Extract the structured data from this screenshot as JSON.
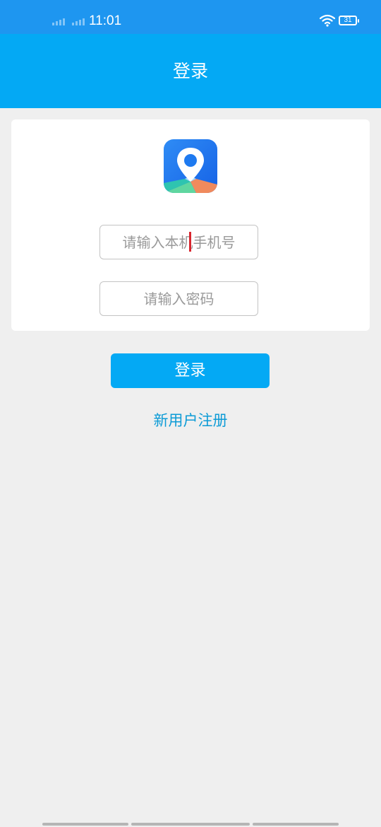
{
  "status_bar": {
    "time": "11:01",
    "battery": "31",
    "icons": [
      "signal-icon",
      "signal-icon",
      "wifi-icon",
      "battery-icon"
    ]
  },
  "header": {
    "title": "登录"
  },
  "login_form": {
    "logo": "map-pin-logo",
    "phone_placeholder": "请输入本机手机号",
    "password_placeholder": "请输入密码",
    "login_button": "登录",
    "register_link": "新用户注册"
  },
  "colors": {
    "status_bar": "#1e96f0",
    "header": "#04a9f4",
    "accent": "#04a9f4",
    "link": "#0c9bd6",
    "background": "#efefef",
    "cursor": "#d8262f"
  }
}
